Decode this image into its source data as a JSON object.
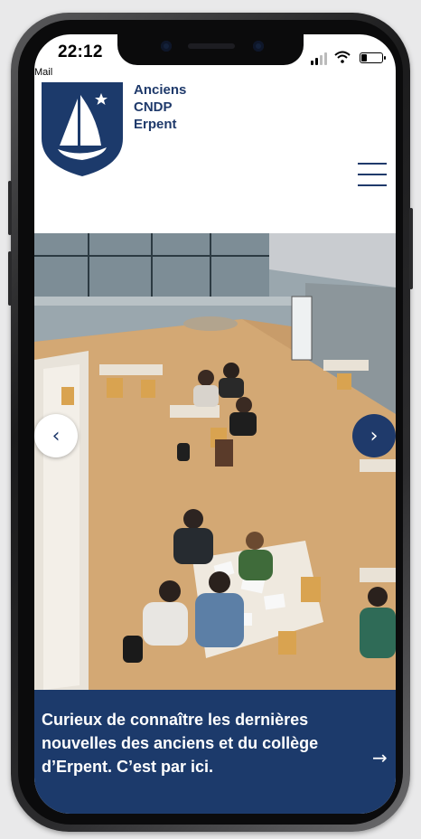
{
  "status_bar": {
    "time": "22:12",
    "back_app": "Mail"
  },
  "site": {
    "brand_line1": "Anciens",
    "brand_line2": "CNDP",
    "brand_line3": "Erpent",
    "logo_icon": "sailboat-shield-icon",
    "menu_icon": "hamburger-menu-icon"
  },
  "carousel": {
    "prev_icon": "chevron-left-icon",
    "prev_glyph": "‹",
    "next_icon": "chevron-right-icon",
    "next_glyph": "›",
    "image": "students-studying-in-study-hall-photo"
  },
  "banner": {
    "text": "Curieux de connaître les dernières nouvelles des anciens et du collège d’Erpent. C’est par ici.",
    "arrow_icon": "arrow-right-icon",
    "arrow_glyph": "→"
  },
  "colors": {
    "brand_navy": "#1c3a6b",
    "white": "#ffffff"
  }
}
